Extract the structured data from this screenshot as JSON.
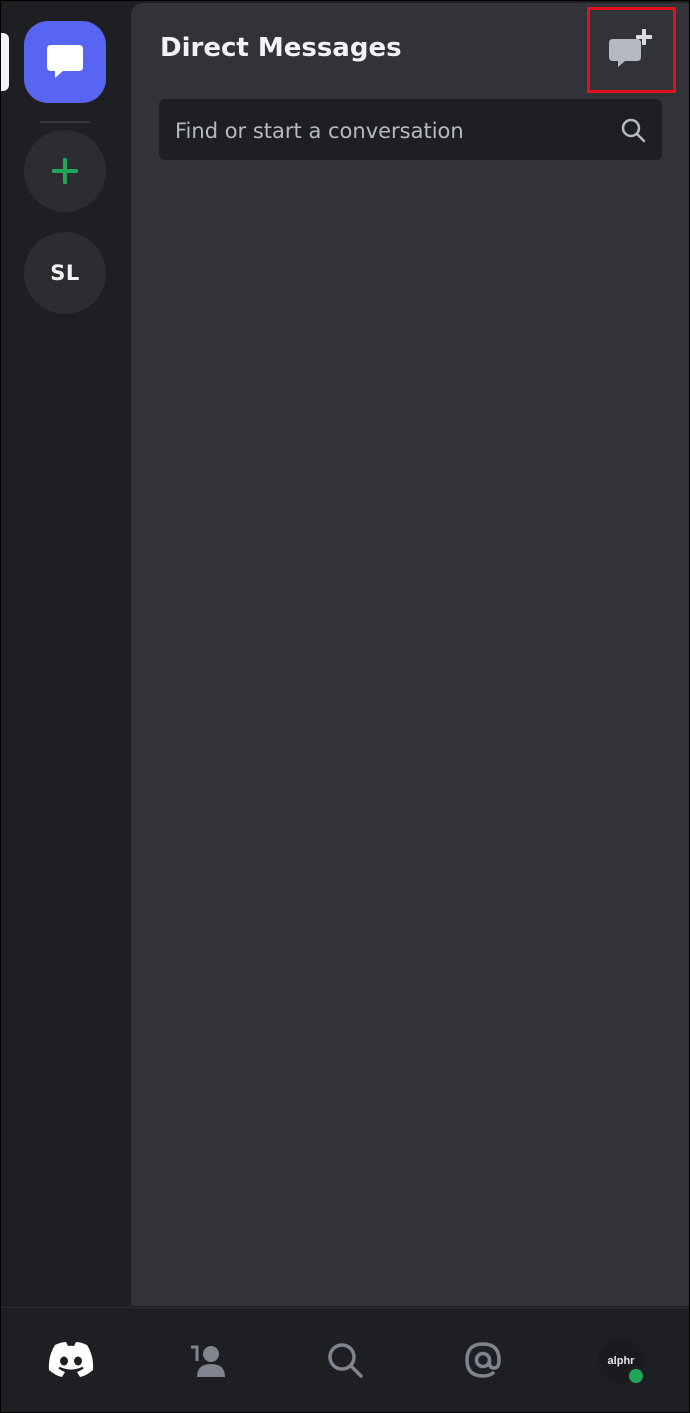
{
  "header": {
    "title": "Direct Messages"
  },
  "search": {
    "placeholder": "Find or start a conversation"
  },
  "servers": [
    {
      "initials": "SL"
    }
  ],
  "bottom_nav": {
    "items": [
      "home",
      "friends",
      "search",
      "mentions",
      "profile"
    ],
    "avatar_text": "alphr"
  },
  "icons": {
    "dm": "chat-bubble-icon",
    "add_server": "plus-icon",
    "new_dm": "new-message-icon",
    "search": "search-icon",
    "home": "discord-logo-icon",
    "friends": "friends-icon",
    "mentions": "at-icon"
  },
  "colors": {
    "blurple": "#5865f2",
    "add_green": "#23a559",
    "highlight_box": "#e3101d",
    "panel_bg": "#313338",
    "rail_bg": "#1e1f22"
  }
}
